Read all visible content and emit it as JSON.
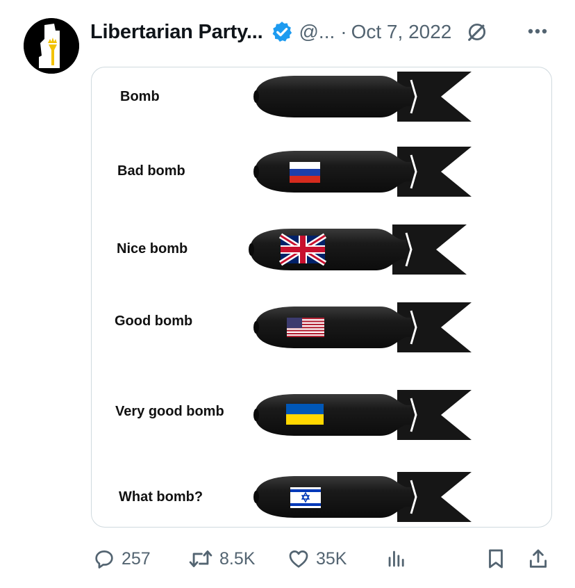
{
  "author": {
    "display_name": "Libertarian Party...",
    "handle": "@...",
    "date": "Oct 7, 2022",
    "separator": "·",
    "verified_color": "#1d9bf0"
  },
  "media": {
    "labels": [
      "Bomb",
      "Bad bomb",
      "Nice bomb",
      "Good bomb",
      "Very good bomb",
      "What bomb?"
    ],
    "flags": [
      "none",
      "russia-flag",
      "uk-flag",
      "us-flag",
      "ukraine-flag",
      "israel-flag"
    ]
  },
  "actions": {
    "replies": "257",
    "reposts": "8.5K",
    "likes": "35K"
  },
  "icons": {
    "reply": "reply-icon",
    "repost": "repost-icon",
    "like": "heart-icon",
    "views": "views-icon",
    "bookmark": "bookmark-icon",
    "share": "share-icon",
    "grok": "grok-icon",
    "more": "more-icon"
  },
  "colors": {
    "text_secondary": "#536471",
    "text_primary": "#0f1419",
    "accent": "#1d9bf0"
  }
}
